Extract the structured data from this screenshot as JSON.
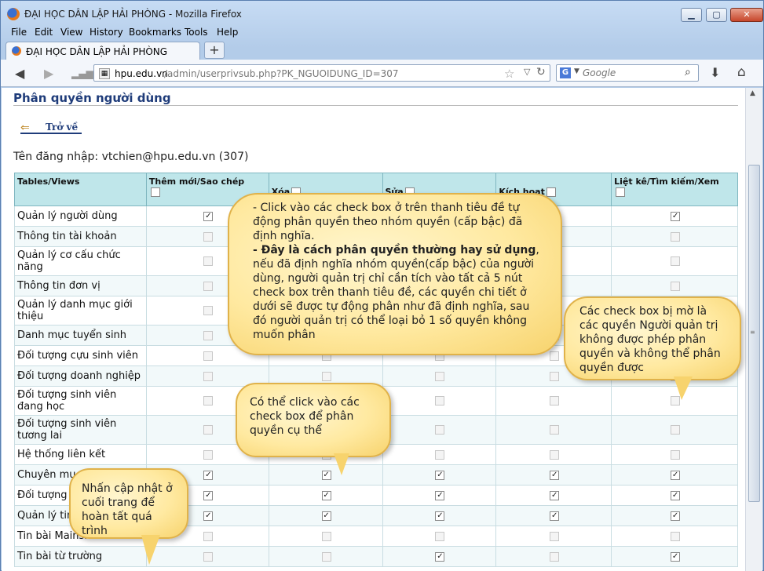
{
  "window": {
    "title": "ĐẠI HỌC DÂN LẬP HẢI PHÒNG - Mozilla Firefox",
    "min": "▁",
    "max": "▢",
    "close": "✕"
  },
  "menu": [
    "File",
    "Edit",
    "View",
    "History",
    "Bookmarks",
    "Tools",
    "Help"
  ],
  "tab": {
    "label": "ĐẠI HỌC DÂN LẬP HẢI PHÒNG",
    "new_tab": "+"
  },
  "url": {
    "host": "hpu.edu.vn",
    "path": "/admin/userprivsub.php?PK_NGUOIDUNG_ID=307"
  },
  "search": {
    "placeholder": "Google",
    "engine": "G"
  },
  "page": {
    "title": "Phân quyền người dùng",
    "back_label": "Trở về",
    "login_line": "Tên đăng nhập: vtchien@hpu.edu.vn (307)"
  },
  "table": {
    "headers": [
      "Tables/Views",
      "Thêm mới/Sao chép",
      "Xóa",
      "Sửa",
      "Kích hoạt",
      "Liệt kê/Tìm kiếm/Xem"
    ],
    "rows": [
      {
        "name": "Quản lý người dùng",
        "cells": [
          "on",
          "on",
          "on",
          "on",
          "on"
        ]
      },
      {
        "name": "Thông tin tài khoản",
        "cells": [
          "dis",
          "dis",
          "dis",
          "dis",
          "dis"
        ]
      },
      {
        "name": "Quản lý cơ cấu chức năng",
        "cells": [
          "dis",
          "dis",
          "dis",
          "dis",
          "dis"
        ]
      },
      {
        "name": "Thông tin đơn vị",
        "cells": [
          "dis",
          "dis",
          "dis",
          "dis",
          "dis"
        ]
      },
      {
        "name": "Quản lý danh mục giới thiệu",
        "cells": [
          "dis",
          "dis",
          "dis",
          "dis",
          "dis"
        ]
      },
      {
        "name": "Danh mục tuyển sinh",
        "cells": [
          "dis",
          "dis",
          "dis",
          "dis",
          "dis"
        ]
      },
      {
        "name": "Đối tượng cựu sinh viên",
        "cells": [
          "dis",
          "dis",
          "dis",
          "dis",
          "dis"
        ]
      },
      {
        "name": "Đối tượng doanh nghiệp",
        "cells": [
          "dis",
          "dis",
          "dis",
          "dis",
          "dis"
        ]
      },
      {
        "name": "Đối tượng sinh viên đang học",
        "cells": [
          "dis",
          "dis",
          "dis",
          "dis",
          "dis"
        ]
      },
      {
        "name": "Đối tượng sinh viên tương lai",
        "cells": [
          "dis",
          "dis",
          "dis",
          "dis",
          "dis"
        ]
      },
      {
        "name": "Hệ thống liên kết",
        "cells": [
          "dis",
          "dis",
          "dis",
          "dis",
          "dis"
        ]
      },
      {
        "name": "Chuyên mu",
        "cells": [
          "on",
          "on",
          "on",
          "on",
          "on"
        ]
      },
      {
        "name": "Đối tượng",
        "cells": [
          "on",
          "on",
          "on",
          "on",
          "on"
        ]
      },
      {
        "name": "Quản lý tin",
        "cells": [
          "on",
          "on",
          "on",
          "on",
          "on"
        ]
      },
      {
        "name": "Tin bài Mainsite",
        "cells": [
          "dis",
          "dis",
          "dis",
          "dis",
          "dis"
        ]
      },
      {
        "name": "Tin bài từ trường",
        "cells": [
          "dis",
          "dis",
          "on",
          "dis",
          "on"
        ]
      }
    ]
  },
  "callouts": {
    "main_1": "- Click vào các check box ở trên thanh tiêu đề tự động phân quyền theo nhóm quyền (cấp bậc) đã định nghĩa.",
    "main_2_bold": "- Đây là cách phân quyền thường hay sử dụng",
    "main_2_rest": ", nếu đã định nghĩa nhóm quyền(cấp bậc) của người dùng, người quản trị chỉ cần tích vào tất cả 5 nút check box trên thanh tiêu đề, các quyền chi tiết ở dưới sẽ được tự động phân như đã định nghĩa, sau đó người quản trị có thể loại bỏ 1 số quyền không muốn phân",
    "disabled": "Các check box bị mờ là các quyền Người quản trị không được phép phân quyền và không thể phân quyền được",
    "click": "Có thể click vào các check box để phân quyền cụ thể",
    "update": "Nhấn cập nhật ở cuối trang để hoàn tất quá trình"
  }
}
